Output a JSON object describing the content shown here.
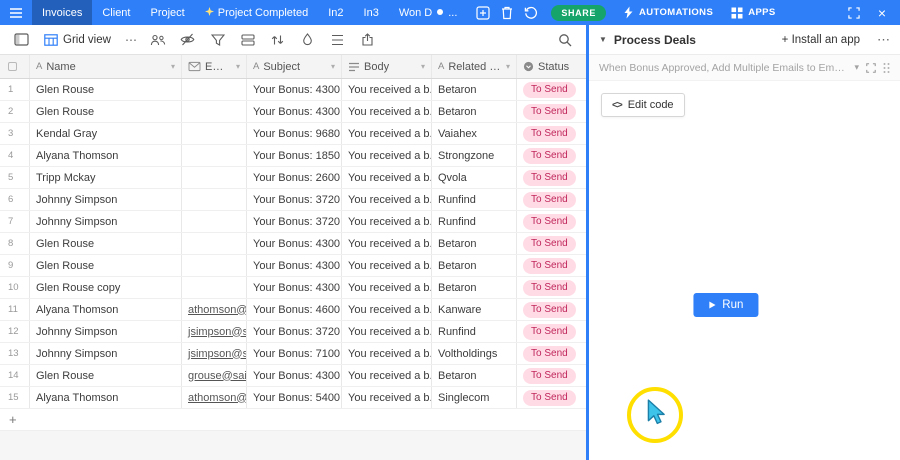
{
  "topbar": {
    "tabs": [
      {
        "label": "Invoices",
        "active": true
      },
      {
        "label": "Client"
      },
      {
        "label": "Project"
      },
      {
        "label": "Project Completed",
        "leading_icon": "sparkle"
      },
      {
        "label": "In2"
      },
      {
        "label": "In3"
      },
      {
        "label": "Won D",
        "trailing_icon": "dot",
        "trailing_text": "..."
      }
    ],
    "share_label": "SHARE",
    "automations_label": "AUTOMATIONS",
    "apps_label": "APPS"
  },
  "toolbar": {
    "view_name": "Grid view"
  },
  "table": {
    "columns": [
      {
        "key": "name",
        "label": "Name",
        "icon": "text-field",
        "menu": true
      },
      {
        "key": "email",
        "label": "Email",
        "icon": "email-field",
        "menu": true
      },
      {
        "key": "subject",
        "label": "Subject",
        "icon": "text-field",
        "menu": true
      },
      {
        "key": "body",
        "label": "Body",
        "icon": "longtext-field",
        "menu": true
      },
      {
        "key": "related",
        "label": "Related C...",
        "icon": "text-field",
        "menu": true
      },
      {
        "key": "status",
        "label": "Status",
        "icon": "select-field",
        "menu": false
      }
    ],
    "rows": [
      {
        "num": 1,
        "name": "Glen Rouse",
        "email": "",
        "subject": "Your Bonus: 4300",
        "body": "You received a b...",
        "related": "Betaron",
        "status": "To Send"
      },
      {
        "num": 2,
        "name": "Glen Rouse",
        "email": "",
        "subject": "Your Bonus: 4300",
        "body": "You received a b...",
        "related": "Betaron",
        "status": "To Send"
      },
      {
        "num": 3,
        "name": "Kendal Gray",
        "email": "",
        "subject": "Your Bonus: 9680",
        "body": "You received a b...",
        "related": "Vaiahex",
        "status": "To Send"
      },
      {
        "num": 4,
        "name": "Alyana Thomson",
        "email": "",
        "subject": "Your Bonus: 1850",
        "body": "You received a b...",
        "related": "Strongzone",
        "status": "To Send"
      },
      {
        "num": 5,
        "name": "Tripp Mckay",
        "email": "",
        "subject": "Your Bonus: 2600",
        "body": "You received a b...",
        "related": "Qvola",
        "status": "To Send"
      },
      {
        "num": 6,
        "name": "Johnny Simpson",
        "email": "",
        "subject": "Your Bonus: 3720",
        "body": "You received a b...",
        "related": "Runfind",
        "status": "To Send"
      },
      {
        "num": 7,
        "name": "Johnny Simpson",
        "email": "",
        "subject": "Your Bonus: 3720",
        "body": "You received a b...",
        "related": "Runfind",
        "status": "To Send"
      },
      {
        "num": 8,
        "name": "Glen Rouse",
        "email": "",
        "subject": "Your Bonus: 4300",
        "body": "You received a b...",
        "related": "Betaron",
        "status": "To Send"
      },
      {
        "num": 9,
        "name": "Glen Rouse",
        "email": "",
        "subject": "Your Bonus: 4300",
        "body": "You received a b...",
        "related": "Betaron",
        "status": "To Send"
      },
      {
        "num": 10,
        "name": "Glen Rouse copy",
        "email": "",
        "subject": "Your Bonus: 4300",
        "body": "You received a b...",
        "related": "Betaron",
        "status": "To Send"
      },
      {
        "num": 11,
        "name": "Alyana Thomson",
        "email": "athomson@sail...",
        "subject": "Your Bonus: 4600",
        "body": "You received a b...",
        "related": "Kanware",
        "status": "To Send"
      },
      {
        "num": 12,
        "name": "Johnny Simpson",
        "email": "jsimpson@sailc...",
        "subject": "Your Bonus: 3720",
        "body": "You received a b...",
        "related": "Runfind",
        "status": "To Send"
      },
      {
        "num": 13,
        "name": "Johnny Simpson",
        "email": "jsimpson@sailc...",
        "subject": "Your Bonus: 7100",
        "body": "You received a b...",
        "related": "Voltholdings",
        "status": "To Send"
      },
      {
        "num": 14,
        "name": "Glen Rouse",
        "email": "grouse@sailcor...",
        "subject": "Your Bonus: 4300",
        "body": "You received a b...",
        "related": "Betaron",
        "status": "To Send"
      },
      {
        "num": 15,
        "name": "Alyana Thomson",
        "email": "athomson@sail...",
        "subject": "Your Bonus: 5400",
        "body": "You received a b...",
        "related": "Singlecom",
        "status": "To Send"
      }
    ],
    "add_row_label": "+"
  },
  "panel": {
    "title": "Process Deals",
    "install_label": "+ Install an app",
    "automation_summary": "When Bonus Approved, Add Multiple Emails to Emai...",
    "edit_code_label": "Edit code",
    "run_label": "Run"
  },
  "colors": {
    "accent": "#2e7ff8",
    "share_green": "#16a46a",
    "status_pill_bg": "#ffdce5",
    "status_pill_text": "#c0265c",
    "highlight_yellow": "#ffdf00"
  }
}
